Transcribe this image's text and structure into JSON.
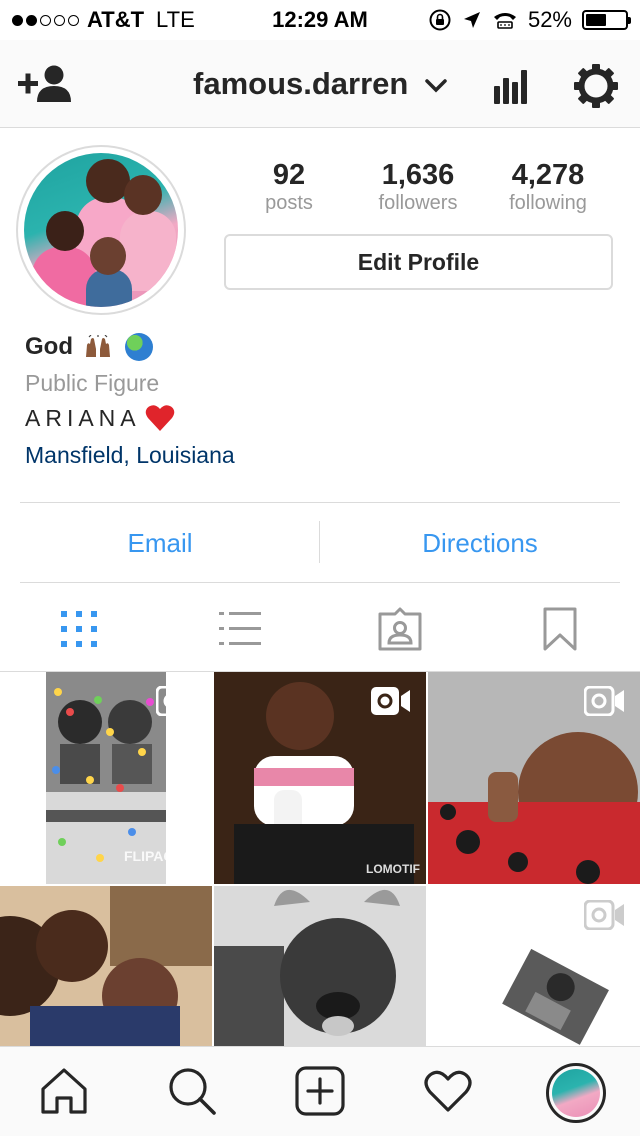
{
  "status_bar": {
    "carrier": "AT&T",
    "network": "LTE",
    "time": "12:29 AM",
    "battery": "52%",
    "signal_bars_filled": 2,
    "signal_bars_total": 5,
    "battery_level": 0.52
  },
  "header": {
    "username": "famous.darren",
    "icons": [
      "add-user-icon",
      "chevron-down-icon",
      "insights-icon",
      "gear-icon"
    ]
  },
  "profile": {
    "stats": [
      {
        "value": "92",
        "label": "posts"
      },
      {
        "value": "1,636",
        "label": "followers"
      },
      {
        "value": "4,278",
        "label": "following"
      }
    ],
    "edit_button": "Edit Profile",
    "name": "God 🙌🏾 🌎",
    "name_text": "God",
    "category": "Public Figure",
    "bio": "A R I A N A ❤️",
    "bio_text": "ARIANA",
    "location": "Mansfield, Louisiana"
  },
  "contact": {
    "email": "Email",
    "directions": "Directions"
  },
  "view_tabs": [
    {
      "name": "grid-view",
      "icon": "grid-icon",
      "active": true
    },
    {
      "name": "list-view",
      "icon": "list-icon",
      "active": false
    },
    {
      "name": "tagged",
      "icon": "tagged-photos-icon",
      "active": false
    },
    {
      "name": "saved",
      "icon": "bookmark-icon",
      "active": false
    }
  ],
  "grid": {
    "posts": [
      {
        "type": "video",
        "overlay_text": "FLIPAGRAM"
      },
      {
        "type": "video",
        "overlay_text": "LOMOTIF"
      },
      {
        "type": "video",
        "overlay_text": ""
      },
      {
        "type": "photo",
        "overlay_text": ""
      },
      {
        "type": "photo",
        "overlay_text": ""
      },
      {
        "type": "video",
        "overlay_text": ""
      }
    ]
  },
  "bottom_nav": [
    "home-icon",
    "search-icon",
    "new-post-icon",
    "activity-heart-icon",
    "profile-avatar"
  ],
  "colors": {
    "link_blue": "#3897f0",
    "location_blue": "#003569",
    "muted": "#999999",
    "border": "#dbdbdb"
  }
}
